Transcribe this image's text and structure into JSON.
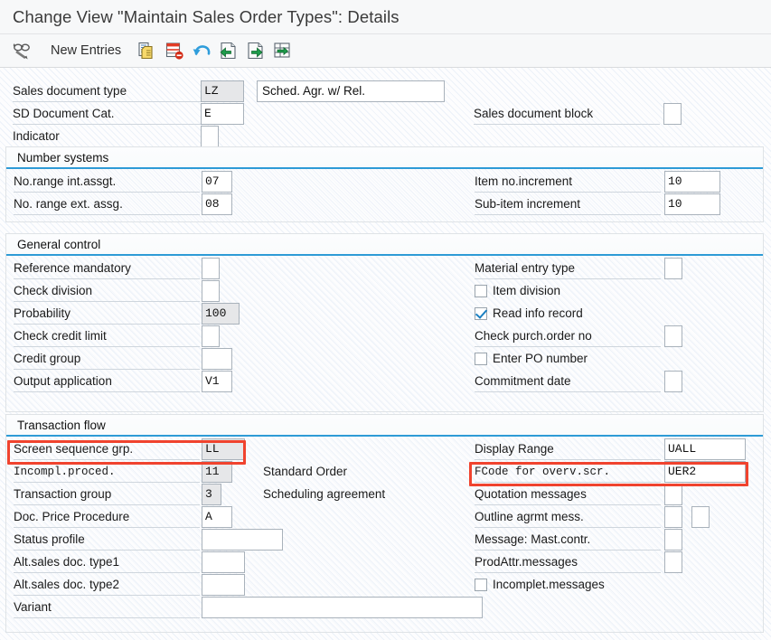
{
  "window": {
    "title": "Change View \"Maintain Sales Order Types\": Details"
  },
  "toolbar": {
    "display_change_icon": "glasses-pencil-icon",
    "new_entries_label": "New Entries",
    "copy_icon": "copy-document-icon",
    "delete_icon": "delete-row-icon",
    "undo_icon": "undo-arrow-icon",
    "previous_entry_icon": "previous-entry-icon",
    "next_entry_icon": "next-entry-icon",
    "select_layout_icon": "table-arrow-icon"
  },
  "header_fields": {
    "sales_document_type": {
      "label": "Sales document type",
      "value": "LZ",
      "description": "Sched. Agr. w/ Rel."
    },
    "sd_document_cat": {
      "label": "SD Document Cat.",
      "value": "E"
    },
    "indicator": {
      "label": "Indicator",
      "value": ""
    },
    "sales_document_block": {
      "label": "Sales document block",
      "value": ""
    }
  },
  "sections": [
    {
      "title": "Number systems",
      "left": [
        {
          "label": "No.range int.assgt.",
          "value": "07"
        },
        {
          "label": "No. range ext. assg.",
          "value": "08"
        }
      ],
      "right": [
        {
          "label": "Item no.increment",
          "value": "10"
        },
        {
          "label": "Sub-item increment",
          "value": "10"
        }
      ]
    },
    {
      "title": "General control",
      "left": [
        {
          "label": "Reference mandatory",
          "value": ""
        },
        {
          "label": "Check division",
          "value": ""
        },
        {
          "label": "Probability",
          "value": "100"
        },
        {
          "label": "Check credit limit",
          "value": ""
        },
        {
          "label": "Credit group",
          "value": ""
        },
        {
          "label": "Output application",
          "value": "V1"
        }
      ],
      "right": [
        {
          "label": "Material entry type",
          "value": ""
        },
        {
          "label": "Item division",
          "checked": false
        },
        {
          "label": "Read info record",
          "checked": true
        },
        {
          "label": "Check purch.order no",
          "value": ""
        },
        {
          "label": "Enter PO number",
          "checked": false
        },
        {
          "label": "Commitment  date",
          "value": ""
        }
      ]
    },
    {
      "title": "Transaction flow",
      "left": [
        {
          "label": "Screen sequence grp.",
          "value": "LL"
        },
        {
          "label": "Incompl.proced.",
          "value": "11",
          "side": "Standard Order"
        },
        {
          "label": "Transaction group",
          "value": "3",
          "side": "Scheduling agreement"
        },
        {
          "label": "Doc. Price Procedure",
          "value": "A"
        },
        {
          "label": "Status profile",
          "value": ""
        },
        {
          "label": "Alt.sales doc. type1",
          "value": ""
        },
        {
          "label": "Alt.sales doc. type2",
          "value": ""
        },
        {
          "label": "Variant",
          "value": ""
        }
      ],
      "right": [
        {
          "label": "Display Range",
          "value": "UALL"
        },
        {
          "label": "FCode for overv.scr.",
          "value": "UER2"
        },
        {
          "label": "Quotation messages",
          "value": ""
        },
        {
          "label": "Outline agrmt mess.",
          "value": "",
          "value2": ""
        },
        {
          "label": "Message: Mast.contr.",
          "value": ""
        },
        {
          "label": "ProdAttr.messages",
          "value": ""
        },
        {
          "label": "Incomplet.messages",
          "checked": false
        }
      ]
    }
  ],
  "highlights": {
    "accent_color": "#f0432e",
    "screen_sequence_grp": "Screen sequence grp.",
    "fcode_for_overv_scr": "FCode for overv.scr."
  }
}
